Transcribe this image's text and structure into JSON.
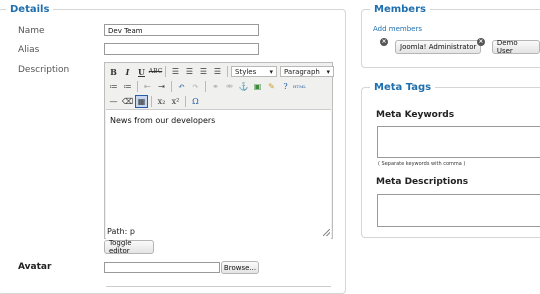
{
  "details": {
    "legend": "Details",
    "name_label": "Name",
    "name_value": "Dev Team",
    "alias_label": "Alias",
    "alias_value": "",
    "description_label": "Description",
    "avatar_label": "Avatar",
    "toggle_editor": "Toggle editor",
    "browse": "Browse..."
  },
  "editor": {
    "styles_label": "Styles",
    "paragraph_label": "Paragraph",
    "content": "News from our developers",
    "path": "Path: p",
    "buttons_row1": [
      "B",
      "I",
      "U",
      "ABC"
    ],
    "html_label": "HTML"
  },
  "members": {
    "legend": "Members",
    "add_link": "Add members",
    "items": [
      "Joomla! Administrator",
      "Demo User"
    ]
  },
  "metatags": {
    "legend": "Meta Tags",
    "keywords_label": "Meta Keywords",
    "keywords_hint": "( Separate keywords with comma )",
    "descriptions_label": "Meta Descriptions"
  }
}
